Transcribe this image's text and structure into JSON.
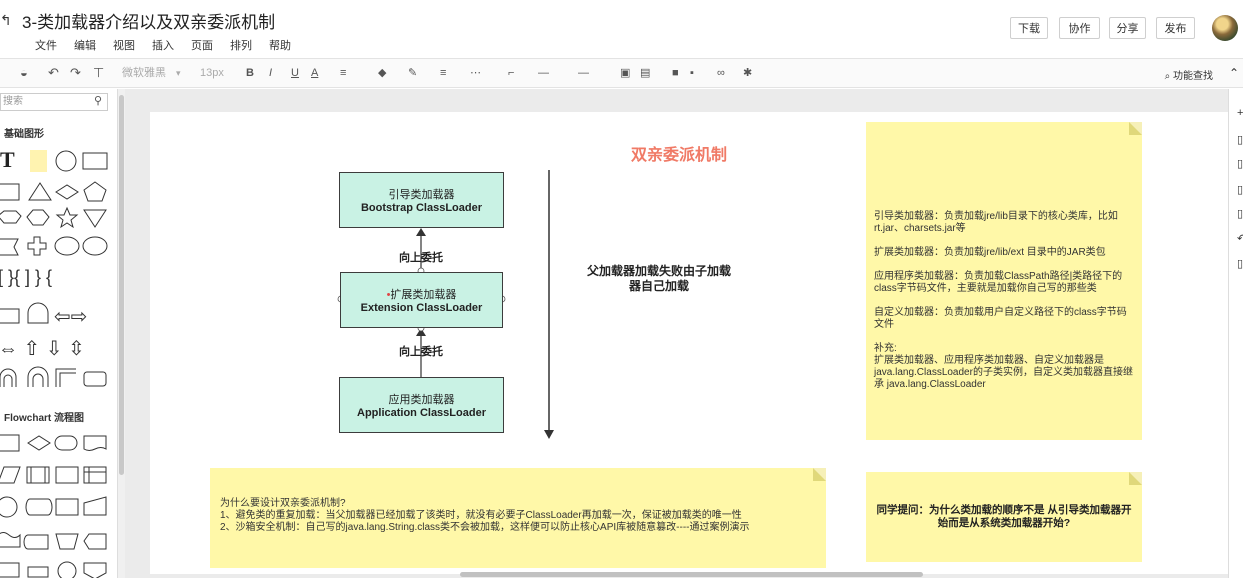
{
  "header": {
    "title": "3-类加载器介绍以及双亲委派机制",
    "menus": [
      "文件",
      "编辑",
      "视图",
      "插入",
      "页面",
      "排列",
      "帮助"
    ],
    "buttons": {
      "download": "下载",
      "collab": "协作",
      "share": "分享",
      "publish": "发布"
    }
  },
  "toolbar": {
    "font": "微软雅黑",
    "size": "13px",
    "bold": "B",
    "italic": "I",
    "underline": "U",
    "font_color": "A",
    "search": "功能查找"
  },
  "left_panel": {
    "search_placeholder": "搜索",
    "section_basic": "基础图形",
    "section_flow": "Flowchart 流程图"
  },
  "diagram": {
    "title": "双亲委派机制",
    "boxes": [
      {
        "cn": "引导类加载器",
        "en": "Bootstrap ClassLoader"
      },
      {
        "cn": "扩展类加载器",
        "en": "Extension ClassLoader"
      },
      {
        "cn": "应用类加载器",
        "en": "Application ClassLoader"
      }
    ],
    "edge_top": "向上委托",
    "edge_bottom": "向上委托",
    "side_note": "父加载器加载失败由子加载器自己加载"
  },
  "notes": {
    "bottom": [
      "为什么要设计双亲委派机制?",
      "1、避免类的重复加载：当父加载器已经加载了该类时，就没有必要子ClassLoader再加载一次，保证被加载类的唯一性",
      "2、沙箱安全机制：自己写的java.lang.String.class类不会被加载，这样便可以防止核心API库被随意篡改----通过案例演示"
    ],
    "right": [
      "引导类加载器：负责加载jre/lib目录下的核心类库，比如rt.jar、charsets.jar等",
      "",
      "扩展类加载器：负责加载jre/lib/ext 目录中的JAR类包",
      "",
      "应用程序类加载器：负责加载ClassPath路径|类路径下的class字节码文件，主要就是加载你自己写的那些类",
      "",
      "自定义加载器：负责加载用户自定义路径下的class字节码文件",
      "",
      "补充:",
      "扩展类加载器、应用程序类加载器、自定义加载器是java.lang.ClassLoader的子类实例，自定义类加载器直接继承 java.lang.ClassLoader"
    ],
    "question": "同学提问：为什么类加载的顺序不是 从引导类加载器开始而是从系统类加载器开始?"
  },
  "colors": {
    "box_fill": "#c9f2e4",
    "sticky": "#fff8a8",
    "title_red": "#f07a66"
  }
}
